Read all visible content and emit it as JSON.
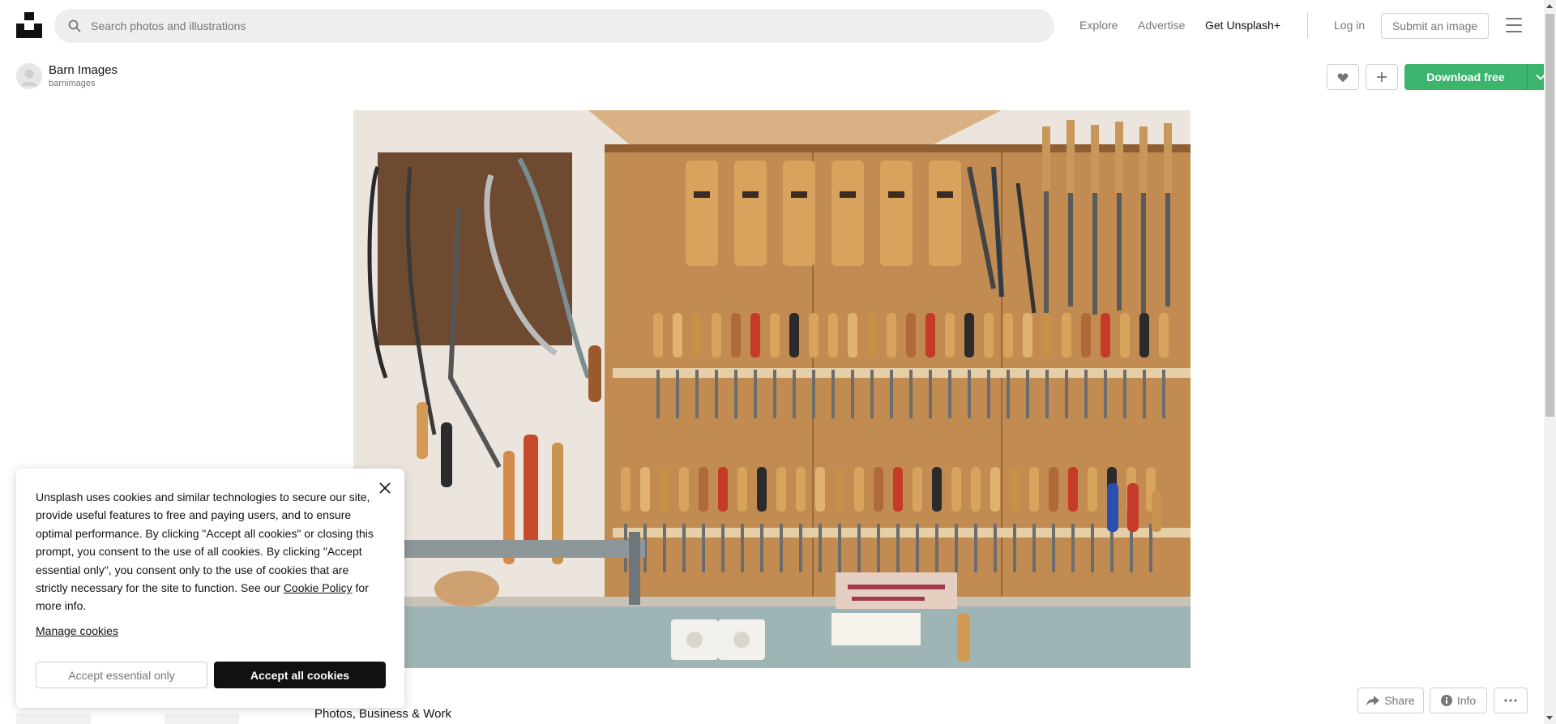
{
  "header": {
    "search_placeholder": "Search photos and illustrations",
    "nav": {
      "explore": "Explore",
      "advertise": "Advertise",
      "get_plus": "Get Unsplash+",
      "login": "Log in",
      "submit": "Submit an image"
    }
  },
  "author": {
    "name": "Barn Images",
    "handle": "barnimages"
  },
  "actions": {
    "download": "Download free",
    "like_icon": "heart-icon",
    "add_icon": "plus-icon"
  },
  "photo": {
    "subject": "Workshop wall with hand tools"
  },
  "bottom": {
    "tags": "Photos, Business & Work",
    "share": "Share",
    "info": "Info"
  },
  "cookie": {
    "text_before": "Unsplash uses cookies and similar technologies to secure our site, provide useful features to free and paying users, and to ensure optimal performance. By clicking \"Accept all cookies\" or closing this prompt, you consent to the use of all cookies. By clicking \"Accept essential only\", you consent only to the use of cookies that are strictly necessary for the site to function. See our ",
    "policy_link": "Cookie Policy",
    "text_after": " for more info.",
    "manage": "Manage cookies",
    "essential": "Accept essential only",
    "accept_all": "Accept all cookies"
  },
  "colors": {
    "accent_green": "#3cb46e",
    "text_muted": "#767676"
  }
}
